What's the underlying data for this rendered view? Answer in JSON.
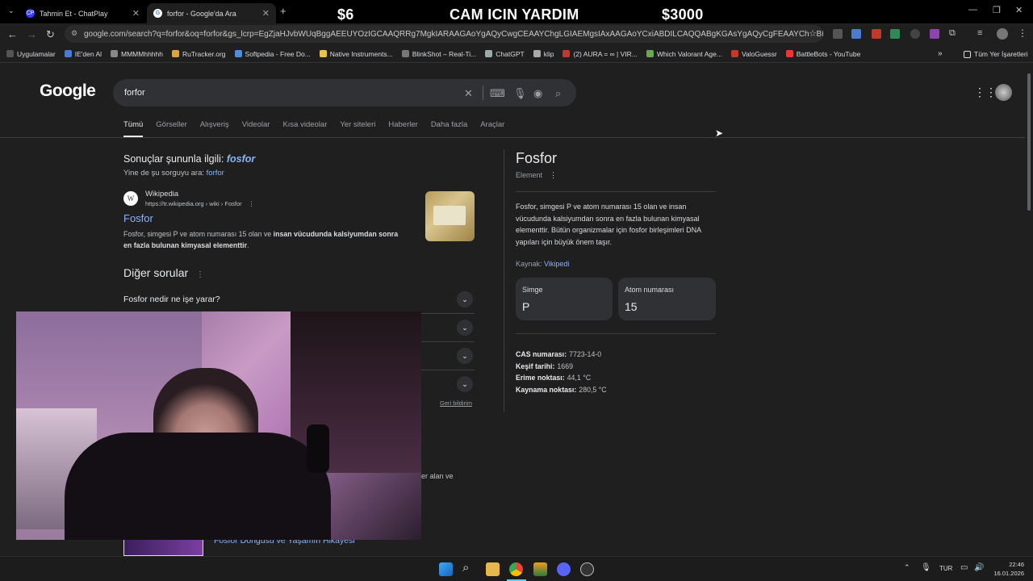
{
  "tabs": [
    {
      "title": "Tahmin Et - ChatPlay",
      "favicon": "CP"
    },
    {
      "title": "forfor - Google'da Ara",
      "favicon": "G"
    }
  ],
  "overlay": {
    "left_price": "$6",
    "title": "CAM ICIN YARDIM",
    "right_price": "$3000"
  },
  "address_bar": {
    "url": "google.com/search?q=forfor&oq=forfor&gs_lcrp=EgZjaHJvbWUqBggAEEUYOzIGCAAQRRg7MgkIARAAGAoYgAQyCwgCEAAYChgLGIAEMgsIAxAAGAoYCxiABDILCAQQABgKGAsYgAQyCgFEAAYChiABDIRCAYQLhgK..."
  },
  "bookmarks": [
    "Uygulamalar",
    "IE'den Al",
    "MMMMhhhhh",
    "RuTracker.org",
    "Softpedia - Free Do...",
    "Native Instruments...",
    "BlinkShot – Real-Ti...",
    "ChatGPT",
    "klip",
    "(2) AURA = ∞ | VIR...",
    "Which Valorant Age...",
    "ValoGuessr",
    "BattleBots - YouTube"
  ],
  "bookmarks_other": "Tüm Yer İşaretleri",
  "google": {
    "logo": "Google",
    "query": "forfor",
    "tabs": [
      "Tümü",
      "Görseller",
      "Alışveriş",
      "Videolar",
      "Kısa videolar",
      "Yer siteleri",
      "Haberler",
      "Daha fazla",
      "Araçlar"
    ],
    "spell": {
      "prefix": "Sonuçlar şununla ilgili: ",
      "corrected": "fosfor",
      "alt_prefix": "Yine de şu sorguyu ara: ",
      "alt_query": "forfor"
    },
    "result": {
      "site": "Wikipedia",
      "url": "https://tr.wikipedia.org › wiki › Fosfor",
      "title": "Fosfor",
      "snippet_plain": "Fosfor, simgesi P ve atom numarası 15 olan ve ",
      "snippet_bold": "insan vücudunda kalsiyumdan sonra en fazla bulunan kimyasal elementtir",
      "snippet_end": "."
    },
    "paa": {
      "heading": "Diğer sorular",
      "q1": "Fosfor nedir ne işe yarar?",
      "feedback": "Geri bildirim"
    },
    "partial_snippet": "er alan ve",
    "partial_video_title": "Fosfor Döngüsü ve Yaşamın Hikayesi",
    "knowledge_panel": {
      "title": "Fosfor",
      "subtitle": "Element",
      "description": "Fosfor, simgesi P ve atom numarası 15 olan ve insan vücudunda kalsiyumdan sonra en fazla bulunan kimyasal elementtir. Bütün organizmalar için fosfor birleşimleri DNA yapıları için büyük önem taşır.",
      "source_label": "Kaynak: ",
      "source_link": "Vikipedi",
      "cards": [
        {
          "label": "Simge",
          "value": "P"
        },
        {
          "label": "Atom numarası",
          "value": "15"
        }
      ],
      "facts": [
        {
          "key": "CAS numarası:",
          "value": "7723-14-0"
        },
        {
          "key": "Keşif tarihi:",
          "value": "1669"
        },
        {
          "key": "Erime noktası:",
          "value": "44,1 °C"
        },
        {
          "key": "Kaynama noktası:",
          "value": "280,5 °C"
        }
      ]
    }
  },
  "taskbar": {
    "lang": "TUR",
    "time": "22:46",
    "date": "16.01.2026"
  },
  "colors": {
    "link": "#8ab4f8",
    "bg": "#1f1f1f",
    "surface": "#303134"
  }
}
